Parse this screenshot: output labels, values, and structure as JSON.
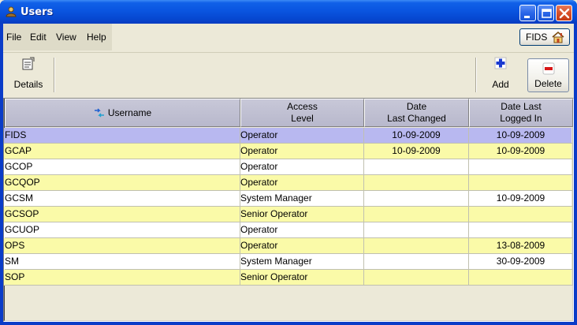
{
  "window": {
    "title": "Users"
  },
  "menu": [
    "File",
    "Edit",
    "View",
    "Help"
  ],
  "home_button": {
    "label": "FIDS"
  },
  "toolbar": {
    "details_label": "Details",
    "add_label": "Add",
    "delete_label": "Delete"
  },
  "table": {
    "columns": [
      {
        "line1": "Username",
        "line2": ""
      },
      {
        "line1": "Access",
        "line2": "Level"
      },
      {
        "line1": "Date",
        "line2": "Last Changed"
      },
      {
        "line1": "Date Last",
        "line2": "Logged In"
      }
    ],
    "rows": [
      {
        "username": "FIDS",
        "access": "Operator",
        "changed": "10-09-2009",
        "logged": "10-09-2009",
        "style": "selected"
      },
      {
        "username": "GCAP",
        "access": "Operator",
        "changed": "10-09-2009",
        "logged": "10-09-2009",
        "style": "yellow"
      },
      {
        "username": "GCOP",
        "access": "Operator",
        "changed": "",
        "logged": "",
        "style": "white"
      },
      {
        "username": "GCQOP",
        "access": "Operator",
        "changed": "",
        "logged": "",
        "style": "yellow"
      },
      {
        "username": "GCSM",
        "access": "System Manager",
        "changed": "",
        "logged": "10-09-2009",
        "style": "white"
      },
      {
        "username": "GCSOP",
        "access": "Senior Operator",
        "changed": "",
        "logged": "",
        "style": "yellow"
      },
      {
        "username": "GCUOP",
        "access": "Operator",
        "changed": "",
        "logged": "",
        "style": "white"
      },
      {
        "username": "OPS",
        "access": "Operator",
        "changed": "",
        "logged": "13-08-2009",
        "style": "yellow"
      },
      {
        "username": "SM",
        "access": "System Manager",
        "changed": "",
        "logged": "30-09-2009",
        "style": "white"
      },
      {
        "username": "SOP",
        "access": "Senior Operator",
        "changed": "",
        "logged": "",
        "style": "yellow"
      }
    ]
  },
  "colors": {
    "selected": "#b8b8f0",
    "yellow": "#fafaa8",
    "white": "#ffffff",
    "header": "#bcbccf",
    "titlebar": "#0a55e0"
  },
  "icons": {
    "window": "users-app-icon",
    "home": "house-icon",
    "details": "details-icon",
    "add": "plus-icon",
    "delete": "minus-icon",
    "sort": "sort-arrows-icon"
  }
}
